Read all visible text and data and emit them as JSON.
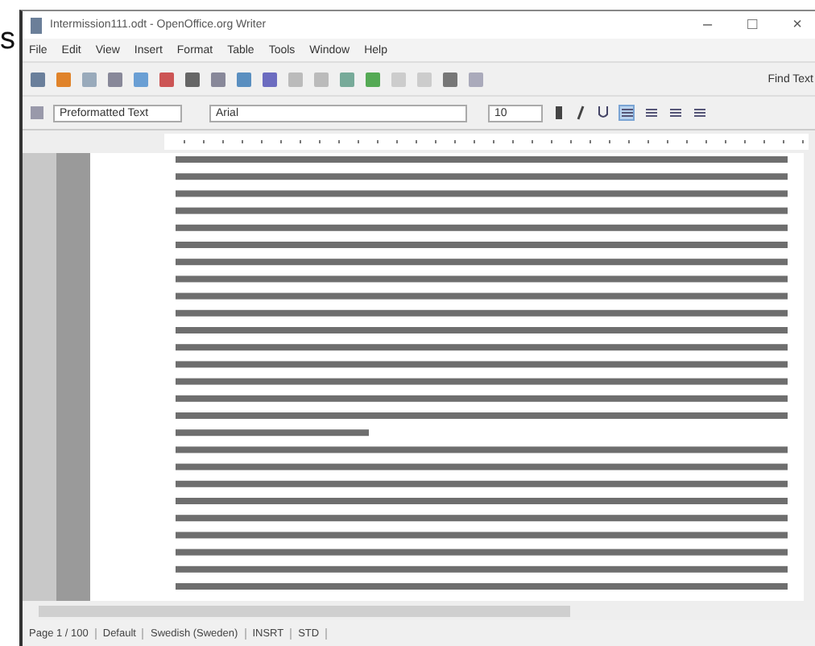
{
  "outside_text": "s",
  "window": {
    "title": "Intermission111.odt - OpenOffice.org Writer",
    "caption_buttons": [
      "–",
      "□",
      "×"
    ]
  },
  "menu": [
    "File",
    "Edit",
    "View",
    "Insert",
    "Format",
    "Table",
    "Tools",
    "Window",
    "Help"
  ],
  "toolbar": {
    "find_label": "Find Text"
  },
  "format_bar": {
    "paragraph_style": "Preformatted Text",
    "font_name": "Arial",
    "font_size": "10",
    "alignments": [
      {
        "selected": true
      },
      {
        "selected": false
      },
      {
        "selected": false
      },
      {
        "selected": false
      }
    ]
  },
  "status_bar": [
    "Page 1 / 100",
    "Default",
    "Swedish (Sweden)",
    "INSRT",
    "STD"
  ]
}
